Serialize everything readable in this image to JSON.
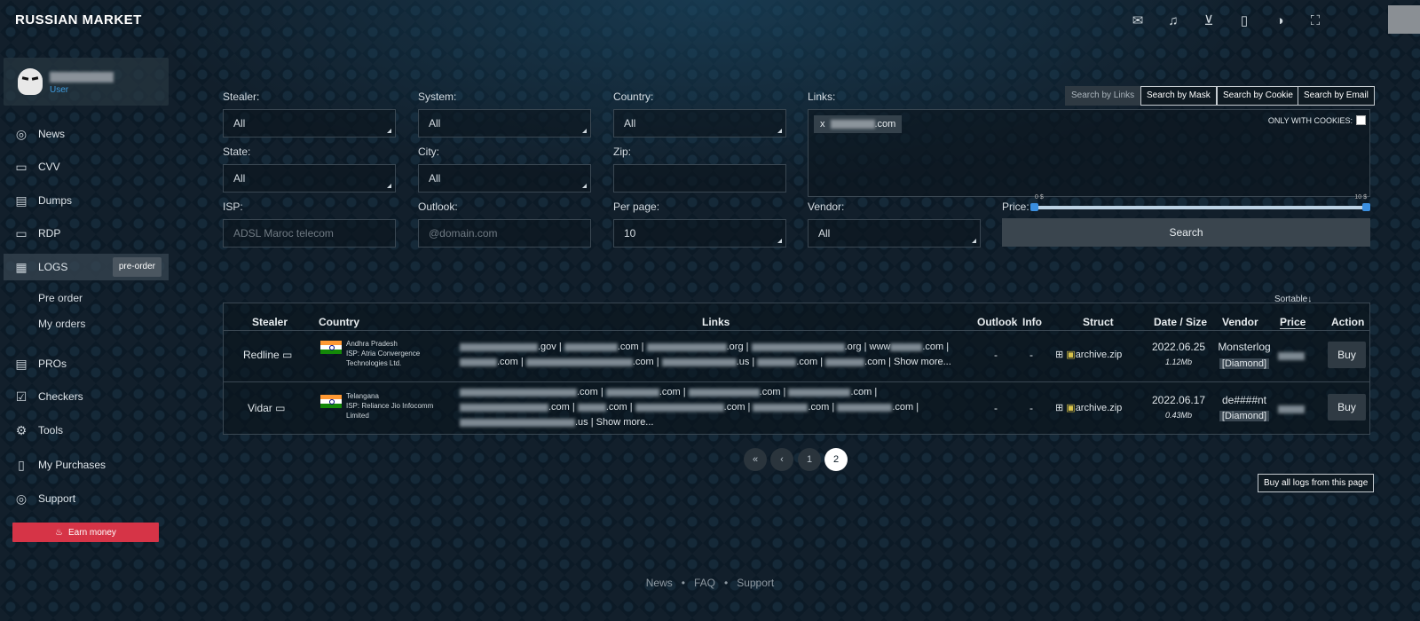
{
  "brand": "RUSSIAN MARKET",
  "top_icons": [
    "mail-icon",
    "bell-icon",
    "cart-icon",
    "bag-icon",
    "palette-icon",
    "fullscreen-icon"
  ],
  "profile": {
    "role": "User"
  },
  "nav": [
    {
      "label": "News",
      "icon": "globe-icon"
    },
    {
      "label": "CVV",
      "icon": "card-icon"
    },
    {
      "label": "Dumps",
      "icon": "dumps-icon"
    },
    {
      "label": "RDP",
      "icon": "monitor-icon"
    },
    {
      "label": "LOGS",
      "icon": "logs-icon",
      "badge": "pre-order"
    },
    {
      "label": "PROs",
      "icon": "pros-icon"
    },
    {
      "label": "Checkers",
      "icon": "check-icon"
    },
    {
      "label": "Tools",
      "icon": "tools-icon"
    },
    {
      "label": "My Purchases",
      "icon": "bag-icon"
    },
    {
      "label": "Support",
      "icon": "support-icon"
    }
  ],
  "subnav": [
    "Pre order",
    "My orders"
  ],
  "earn_label": "Earn money",
  "filters": {
    "stealer": {
      "label": "Stealer:",
      "value": "All"
    },
    "system": {
      "label": "System:",
      "value": "All"
    },
    "country": {
      "label": "Country:",
      "value": "All"
    },
    "links": {
      "label": "Links:"
    },
    "state": {
      "label": "State:",
      "value": "All"
    },
    "city": {
      "label": "City:",
      "value": "All"
    },
    "zip": {
      "label": "Zip:",
      "value": ""
    },
    "isp": {
      "label": "ISP:",
      "placeholder": "ADSL Maroc telecom"
    },
    "outlook": {
      "label": "Outlook:",
      "placeholder": "@domain.com"
    },
    "per_page": {
      "label": "Per page:",
      "value": "10"
    },
    "vendor": {
      "label": "Vendor:",
      "value": "All"
    },
    "price": {
      "label": "Price:",
      "min_label": "0 $",
      "max_label": "10 $",
      "min": 0,
      "max": 10
    }
  },
  "search_modes": [
    "Search by Links",
    "Search by Mask",
    "Search by Cookie",
    "Search by Email"
  ],
  "links_chip": {
    "remove": "x",
    "suffix": ".com"
  },
  "only_cookies": "ONLY WITH COOKIES:",
  "search_button": "Search",
  "sortable": "Sortable↓",
  "table": {
    "headers": [
      "Stealer",
      "Country",
      "Links",
      "Outlook",
      "Info",
      "Struct",
      "Date / Size",
      "Vendor",
      "Price",
      "Action"
    ],
    "rows": [
      {
        "stealer": "Redline",
        "region": "Andhra Pradesh",
        "isp1": "ISP: Atria Convergence",
        "isp2": "Technologies Ltd.",
        "links_line1_tlds": [
          ".gov",
          ".com",
          ".org",
          ".org",
          "www",
          ".com"
        ],
        "links_line2_tlds": [
          ".com",
          ".com",
          ".us",
          ".com",
          ".com"
        ],
        "show_more": "Show more...",
        "outlook": "-",
        "info": "-",
        "struct": "archive.zip",
        "date": "2022.06.25",
        "size": "1.12Mb",
        "vendor": "Monsterlog",
        "vendor_tag": "[Diamond]",
        "action": "Buy"
      },
      {
        "stealer": "Vidar",
        "region": "Telangana",
        "isp1": "ISP: Reliance Jio Infocomm",
        "isp2": "Limited",
        "links_line1_tlds": [
          ".com",
          ".com",
          ".com",
          ".com"
        ],
        "links_line2_tlds": [
          ".com",
          ".com",
          ".com",
          ".com",
          ".com"
        ],
        "links_line3_tlds": [
          ".us"
        ],
        "show_more": "Show more...",
        "outlook": "-",
        "info": "-",
        "struct": "archive.zip",
        "date": "2022.06.17",
        "size": "0.43Mb",
        "vendor": "de####nt",
        "vendor_tag": "[Diamond]",
        "action": "Buy"
      }
    ]
  },
  "pagination": {
    "first": "«",
    "prev": "‹",
    "pages": [
      "1",
      "2"
    ],
    "current": "2"
  },
  "buy_all": "Buy all logs from this page",
  "footer": [
    "News",
    "FAQ",
    "Support"
  ],
  "colors": {
    "accent": "#3b8fe0",
    "earn": "#d63447",
    "background": "#0c1a26"
  }
}
